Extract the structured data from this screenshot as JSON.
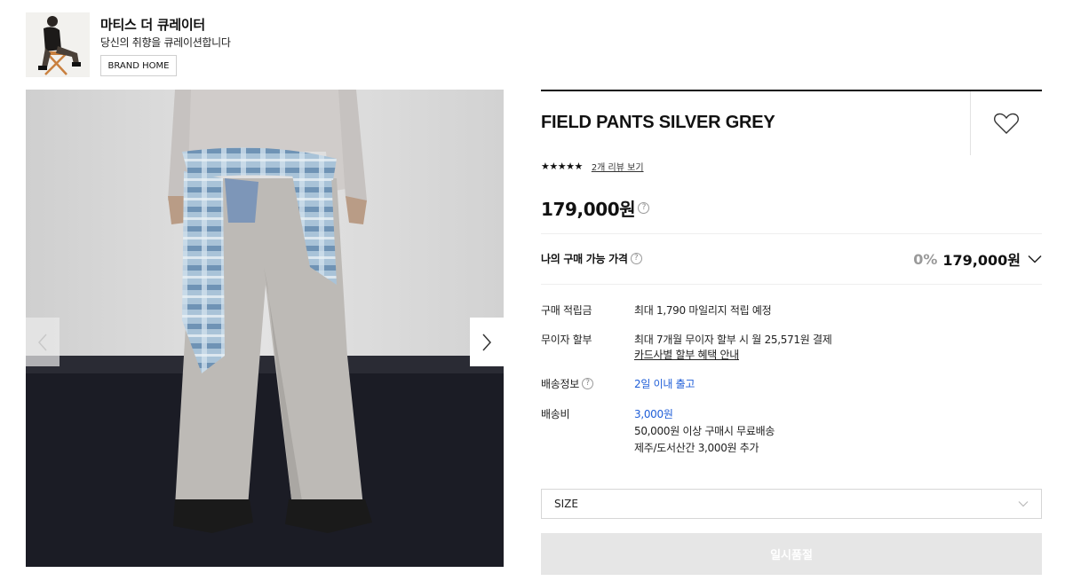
{
  "brand": {
    "name": "마티스 더 큐레이터",
    "description": "당신의 취향을 큐레이션합니다",
    "home_button": "BRAND HOME"
  },
  "product": {
    "title": "FIELD PANTS SILVER GREY",
    "rating_stars": "★★★★★",
    "review_link": "2개 리뷰 보기",
    "price": "179,000원",
    "my_price_label": "나의 구매 가능 가격",
    "discount": "0%",
    "my_price": "179,000원"
  },
  "details": {
    "points_label": "구매 적립금",
    "points_value": "최대 1,790 마일리지 적립 예정",
    "installment_label": "무이자 할부",
    "installment_value": "최대 7개월 무이자 할부 시 월 25,571원 결제",
    "installment_link": "카드사별 할부 혜택 안내",
    "shipping_label": "배송정보",
    "shipping_value": "2일 이내 출고",
    "fee_label": "배송비",
    "fee_value": "3,000원",
    "fee_free": "50,000원 이상 구매시 무료배송",
    "fee_extra": "제주/도서산간 3,000원 추가"
  },
  "options": {
    "size_label": "SIZE",
    "soldout_label": "일시품절"
  },
  "colors": {
    "accent_blue": "#1f5ed8",
    "soldout_bg": "#e6e6e6"
  },
  "icons": {
    "wish": "heart-icon",
    "prev": "chevron-left-icon",
    "next": "chevron-right-icon",
    "dropdown": "chevron-down-icon",
    "help": "question-circle-icon"
  }
}
